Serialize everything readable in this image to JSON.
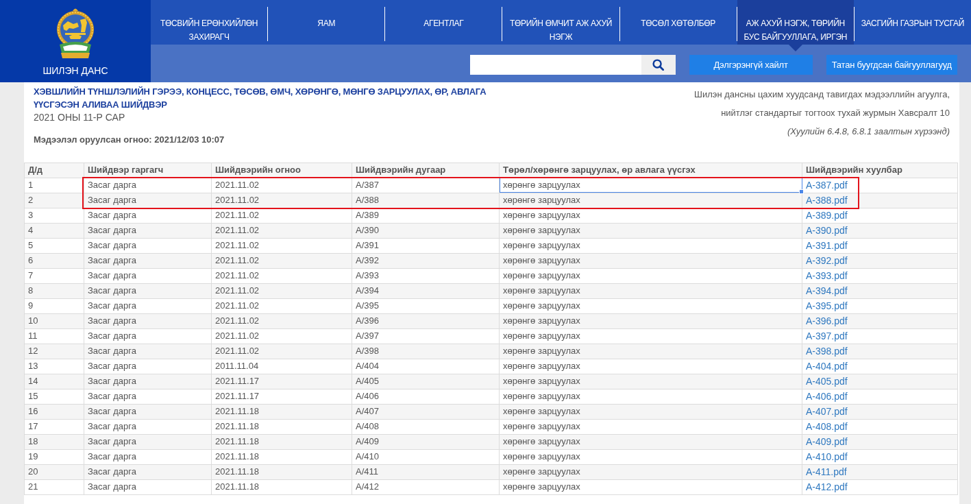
{
  "header": {
    "logo_text": "ШИЛЭН ДАНС",
    "nav": [
      {
        "label": "ТӨСВИЙН ЕРӨНХИЙЛӨН ЗАХИРАГЧ",
        "selected": false
      },
      {
        "label": "ЯАМ",
        "selected": false
      },
      {
        "label": "АГЕНТЛАГ",
        "selected": false
      },
      {
        "label": "ТӨРИЙН ӨМЧИТ АЖ АХУЙ НЭГЖ",
        "selected": false
      },
      {
        "label": "ТӨСӨЛ ХӨТӨЛБӨР",
        "selected": false
      },
      {
        "label": "АЖ АХУЙ НЭГЖ, ТӨРИЙН БУС БАЙГУУЛЛАГА, ИРГЭН",
        "selected": true
      },
      {
        "label": "ЗАСГИЙН ГАЗРЫН ТУСГАЙ",
        "selected": false
      }
    ],
    "buttons": [
      "Дэлгэрэнгүй хайлт",
      "Татан буугдсан байгууллагууд"
    ]
  },
  "title": "ХЭВШЛИЙН ТҮНШЛЭЛИЙН ГЭРЭЭ, КОНЦЕСС, ТӨСӨВ, ӨМЧ, ХӨРӨНГӨ, МӨНГӨ ЗАРЦУУЛАХ, ӨР, АВЛАГА ҮҮСГЭСЭН АЛИВАА ШИЙДВЭР",
  "period": "2021 ОНЫ 11-Р САР",
  "posted": "Мэдээлэл оруулсан огноо: 2021/12/03 10:07",
  "note_lines": [
    "Шилэн дансны цахим хуудсанд тавигдах мэдээллийн агуулга,",
    "нийтлэг стандартыг тогтоох тухай журмын Хавсралт 10"
  ],
  "note_law": "(Хуулийн 6.4.8, 6.8.1 заалтын хүрээнд)",
  "table": {
    "columns": [
      {
        "label": "Д/д",
        "kind": "text"
      },
      {
        "label": "Шийдвэр гаргагч",
        "kind": "text"
      },
      {
        "label": "Шийдвэрийн огноо",
        "kind": "text"
      },
      {
        "label": "Шийдвэрийн дугаар",
        "kind": "text"
      },
      {
        "label": "Төрөл/хөрөнгө зарцуулах, өр авлага үүсгэх",
        "kind": "text"
      },
      {
        "label": "Шийдвэрийн хуулбар",
        "kind": "link"
      }
    ],
    "rows": [
      {
        "cells": [
          "1",
          "Засаг дарга",
          "2021.11.02",
          "А/387",
          "хөрөнгө зарцуулах",
          "A-387.pdf"
        ],
        "highlighted": true,
        "selected": true
      },
      {
        "cells": [
          "2",
          "Засаг дарга",
          "2021.11.02",
          "А/388",
          "хөрөнгө зарцуулах",
          "A-388.pdf"
        ],
        "highlighted": true,
        "selected": false
      },
      {
        "cells": [
          "3",
          "Засаг дарга",
          "2021.11.02",
          "А/389",
          "хөрөнгө зарцуулах",
          "A-389.pdf"
        ],
        "highlighted": false,
        "selected": false
      },
      {
        "cells": [
          "4",
          "Засаг дарга",
          "2021.11.02",
          "А/390",
          "хөрөнгө зарцуулах",
          "A-390.pdf"
        ],
        "highlighted": false,
        "selected": false
      },
      {
        "cells": [
          "5",
          "Засаг дарга",
          "2021.11.02",
          "А/391",
          "хөрөнгө зарцуулах",
          "A-391.pdf"
        ],
        "highlighted": false,
        "selected": false
      },
      {
        "cells": [
          "6",
          "Засаг дарга",
          "2021.11.02",
          "А/392",
          "хөрөнгө зарцуулах",
          "A-392.pdf"
        ],
        "highlighted": false,
        "selected": false
      },
      {
        "cells": [
          "7",
          "Засаг дарга",
          "2021.11.02",
          "А/393",
          "хөрөнгө зарцуулах",
          "A-393.pdf"
        ],
        "highlighted": false,
        "selected": false
      },
      {
        "cells": [
          "8",
          "Засаг дарга",
          "2021.11.02",
          "А/394",
          "хөрөнгө зарцуулах",
          "A-394.pdf"
        ],
        "highlighted": false,
        "selected": false
      },
      {
        "cells": [
          "9",
          "Засаг дарга",
          "2021.11.02",
          "А/395",
          "хөрөнгө зарцуулах",
          "A-395.pdf"
        ],
        "highlighted": false,
        "selected": false
      },
      {
        "cells": [
          "10",
          "Засаг дарга",
          "2021.11.02",
          "А/396",
          "хөрөнгө зарцуулах",
          "A-396.pdf"
        ],
        "highlighted": false,
        "selected": false
      },
      {
        "cells": [
          "11",
          "Засаг дарга",
          "2021.11.02",
          "А/397",
          "хөрөнгө зарцуулах",
          "A-397.pdf"
        ],
        "highlighted": false,
        "selected": false
      },
      {
        "cells": [
          "12",
          "Засаг дарга",
          "2021.11.02",
          "А/398",
          "хөрөнгө зарцуулах",
          "A-398.pdf"
        ],
        "highlighted": false,
        "selected": false
      },
      {
        "cells": [
          "13",
          "Засаг дарга",
          "2011.11.04",
          "А/404",
          "хөрөнгө зарцуулах",
          "A-404.pdf"
        ],
        "highlighted": false,
        "selected": false
      },
      {
        "cells": [
          "14",
          "Засаг дарга",
          "2021.11.17",
          "А/405",
          "хөрөнгө зарцуулах",
          "A-405.pdf"
        ],
        "highlighted": false,
        "selected": false
      },
      {
        "cells": [
          "15",
          "Засаг дарга",
          "2021.11.17",
          "А/406",
          "хөрөнгө зарцуулах",
          "A-406.pdf"
        ],
        "highlighted": false,
        "selected": false
      },
      {
        "cells": [
          "16",
          "Засаг дарга",
          "2021.11.18",
          "А/407",
          "хөрөнгө зарцуулах",
          "A-407.pdf"
        ],
        "highlighted": false,
        "selected": false
      },
      {
        "cells": [
          "17",
          "Засаг дарга",
          "2021.11.18",
          "А/408",
          "хөрөнгө зарцуулах",
          "A-408.pdf"
        ],
        "highlighted": false,
        "selected": false
      },
      {
        "cells": [
          "18",
          "Засаг дарга",
          "2021.11.18",
          "А/409",
          "хөрөнгө зарцуулах",
          "A-409.pdf"
        ],
        "highlighted": false,
        "selected": false
      },
      {
        "cells": [
          "19",
          "Засаг дарга",
          "2021.11.18",
          "А/410",
          "хөрөнгө зарцуулах",
          "A-410.pdf"
        ],
        "highlighted": false,
        "selected": false
      },
      {
        "cells": [
          "20",
          "Засаг дарга",
          "2021.11.18",
          "А/411",
          "хөрөнгө зарцуулах",
          "A-411.pdf"
        ],
        "highlighted": false,
        "selected": false
      },
      {
        "cells": [
          "21",
          "Засаг дарга",
          "2021.11.18",
          "А/412",
          "хөрөнгө зарцуулах",
          "A-412.pdf"
        ],
        "highlighted": false,
        "selected": false
      }
    ]
  }
}
